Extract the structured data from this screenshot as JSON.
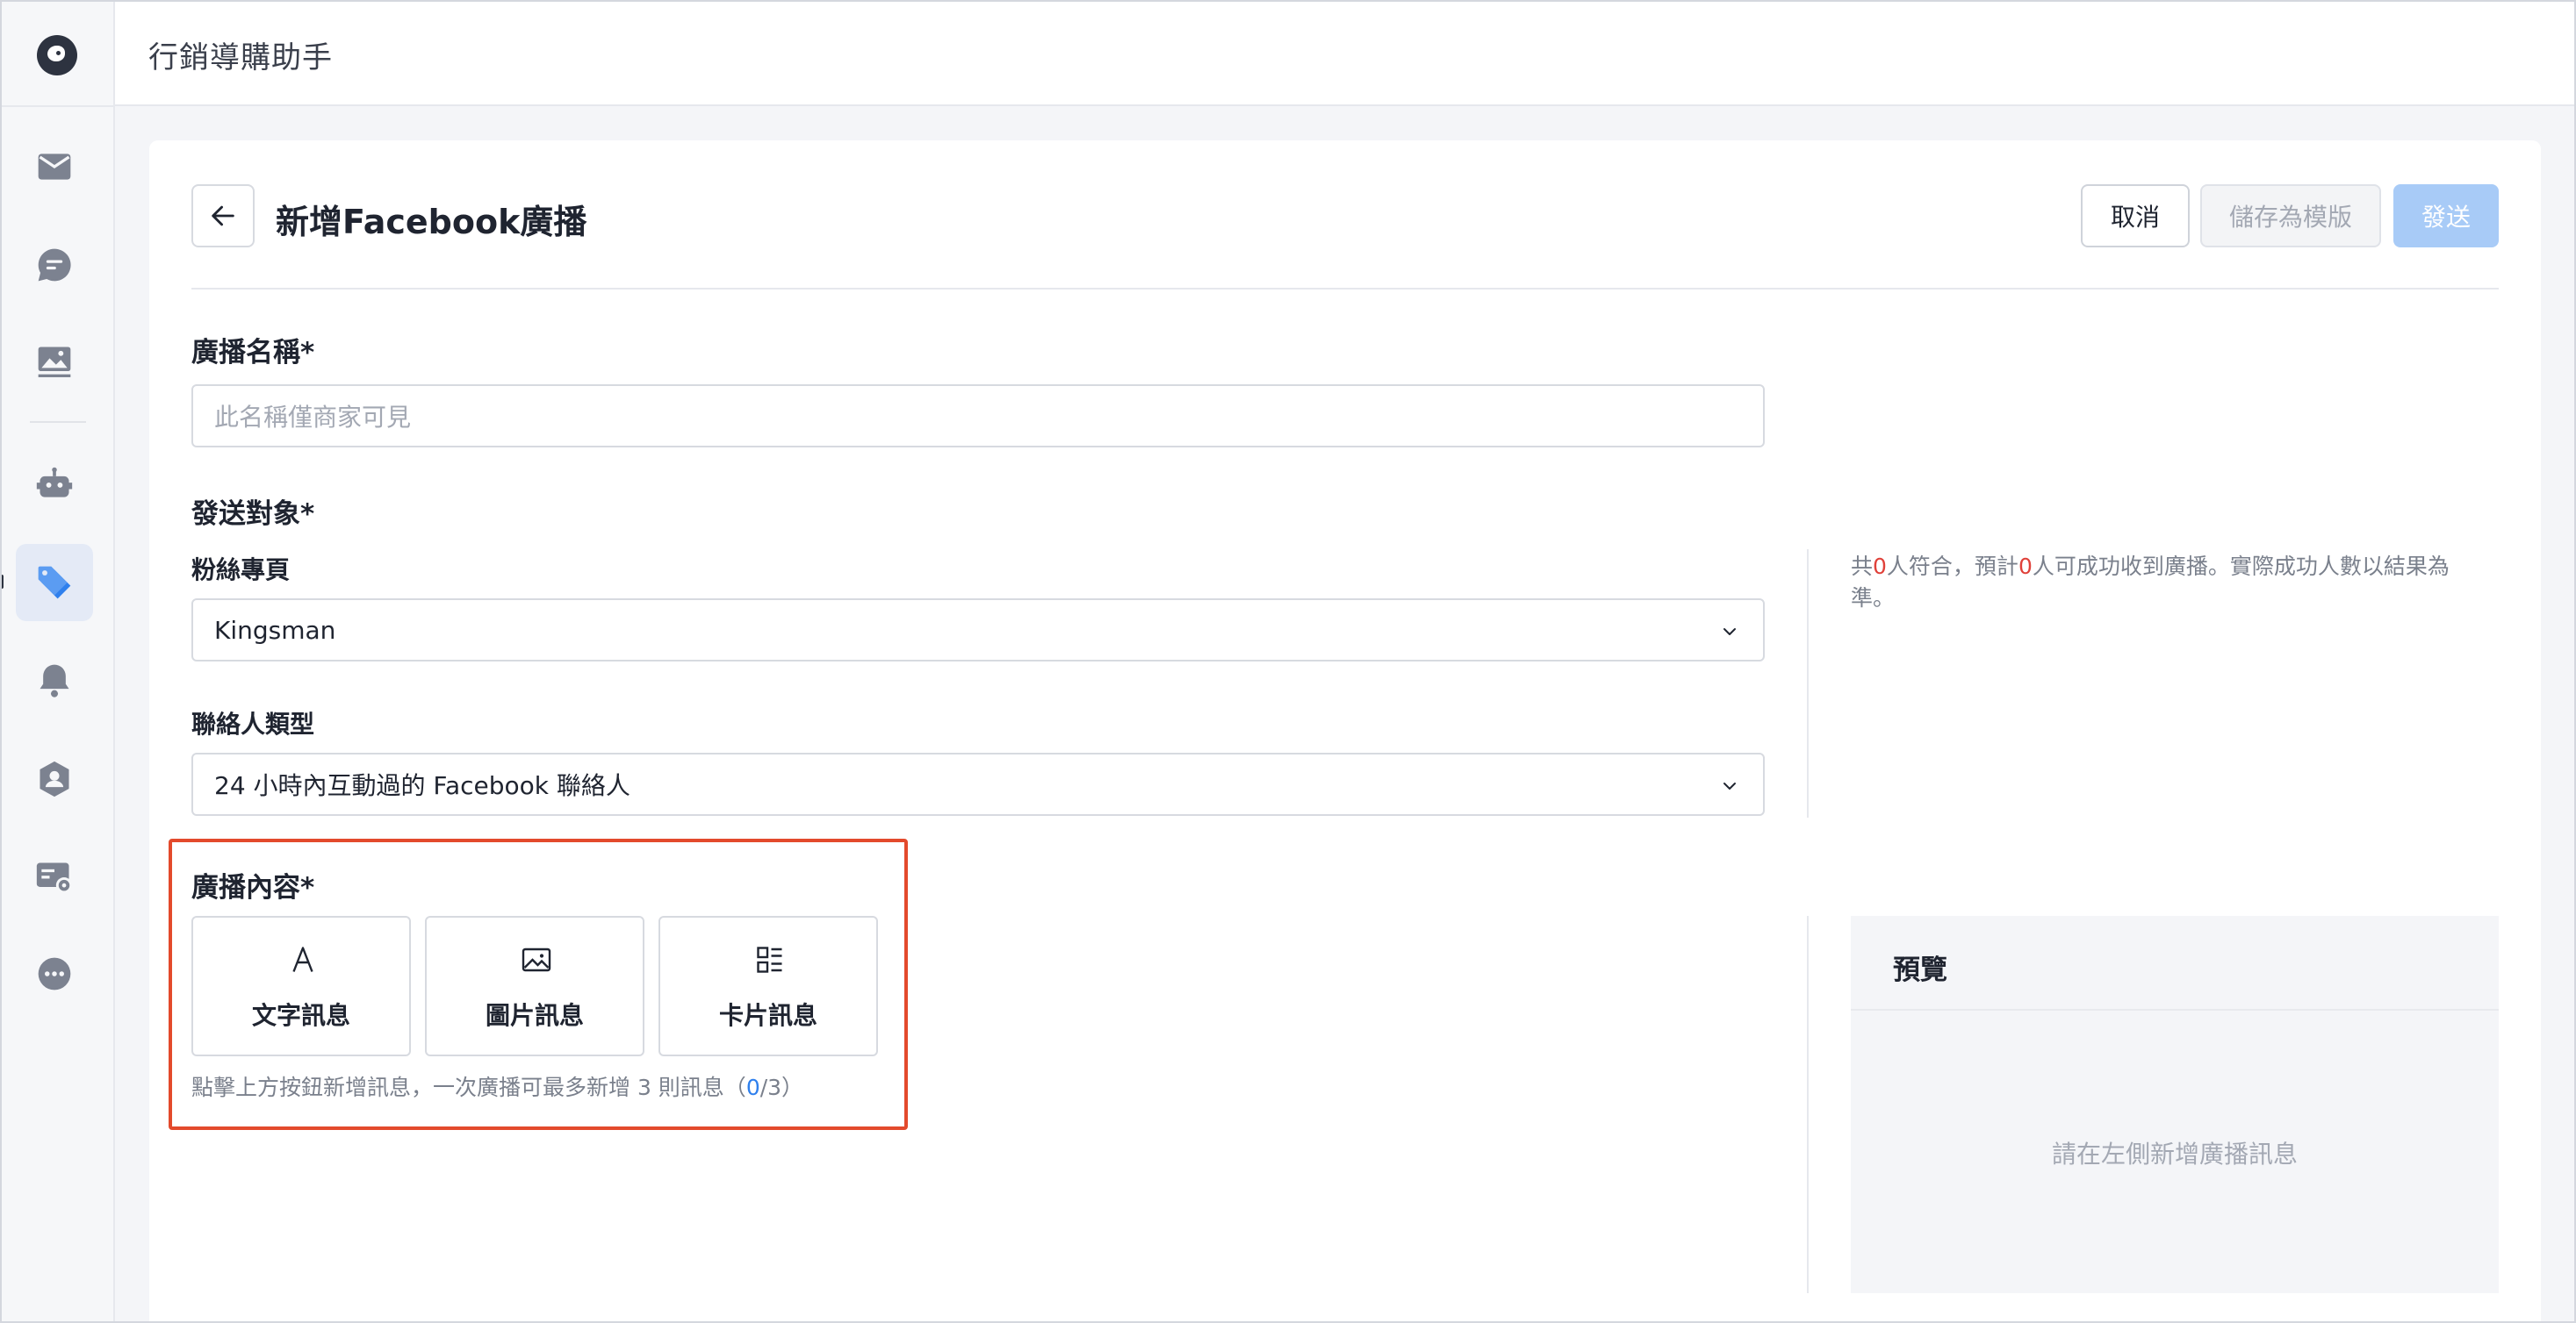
{
  "app": {
    "title": "行銷導購助手"
  },
  "sidebar": {
    "items": [
      {
        "icon": "mail-icon"
      },
      {
        "icon": "chat-icon"
      },
      {
        "icon": "image-icon"
      },
      {
        "icon": "bot-icon"
      },
      {
        "icon": "tag-icon",
        "active": true
      },
      {
        "icon": "bell-icon"
      },
      {
        "icon": "user-badge-icon"
      },
      {
        "icon": "card-settings-icon"
      },
      {
        "icon": "more-icon"
      }
    ]
  },
  "page": {
    "title": "新增Facebook廣播",
    "actions": {
      "cancel": "取消",
      "save_template": "儲存為模版",
      "send": "發送"
    }
  },
  "form": {
    "broadcast_name": {
      "label": "廣播名稱*",
      "placeholder": "此名稱僅商家可見",
      "value": ""
    },
    "audience": {
      "label": "發送對象*",
      "fanpage": {
        "label": "粉絲專頁",
        "value": "Kingsman"
      },
      "contact_type": {
        "label": "聯絡人類型",
        "value": "24 小時內互動過的 Facebook 聯絡人"
      },
      "estimate": {
        "prefix": "共",
        "matched": "0",
        "mid": "人符合，預計",
        "reachable": "0",
        "suffix": "人可成功收到廣播。實際成功人數以結果為準。"
      }
    },
    "content": {
      "label": "廣播內容*",
      "types": [
        {
          "label": "文字訊息",
          "icon": "text-icon"
        },
        {
          "label": "圖片訊息",
          "icon": "image-icon"
        },
        {
          "label": "卡片訊息",
          "icon": "card-list-icon"
        }
      ],
      "hint_prefix": "點擊上方按鈕新增訊息，一次廣播可最多新增 3 則訊息（",
      "count": "0",
      "hint_suffix": "/3）"
    }
  },
  "preview": {
    "title": "預覽",
    "empty": "請在左側新增廣播訊息"
  },
  "colors": {
    "accent": "#2f80ed",
    "send_disabled": "#a8cbf7",
    "highlight_box": "#e34a2c",
    "warning": "#e0413a"
  }
}
